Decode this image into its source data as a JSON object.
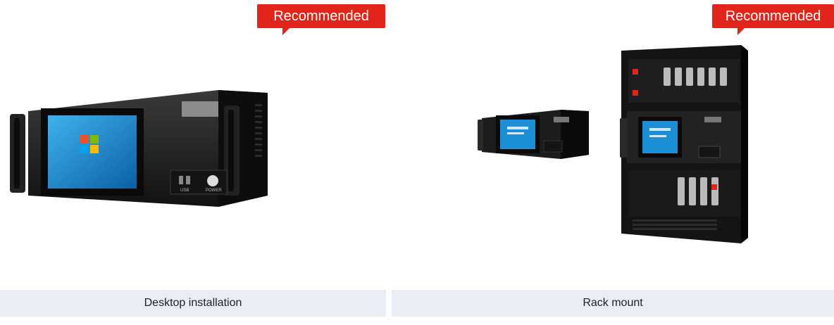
{
  "cards": [
    {
      "badge": "Recommended",
      "caption": "Desktop installation",
      "device": "desktop-industrial-pc"
    },
    {
      "badge": "Recommended",
      "caption": "Rack mount",
      "device": "rack-mount-industrial-pc"
    }
  ],
  "desktop_pc": {
    "usb_label": "USB",
    "power_label": "POWER"
  },
  "colors": {
    "badge": "#e1251b",
    "caption_bg": "#e9eef6",
    "chassis": "#1a1a1a",
    "screen": "#2b8fd0"
  }
}
